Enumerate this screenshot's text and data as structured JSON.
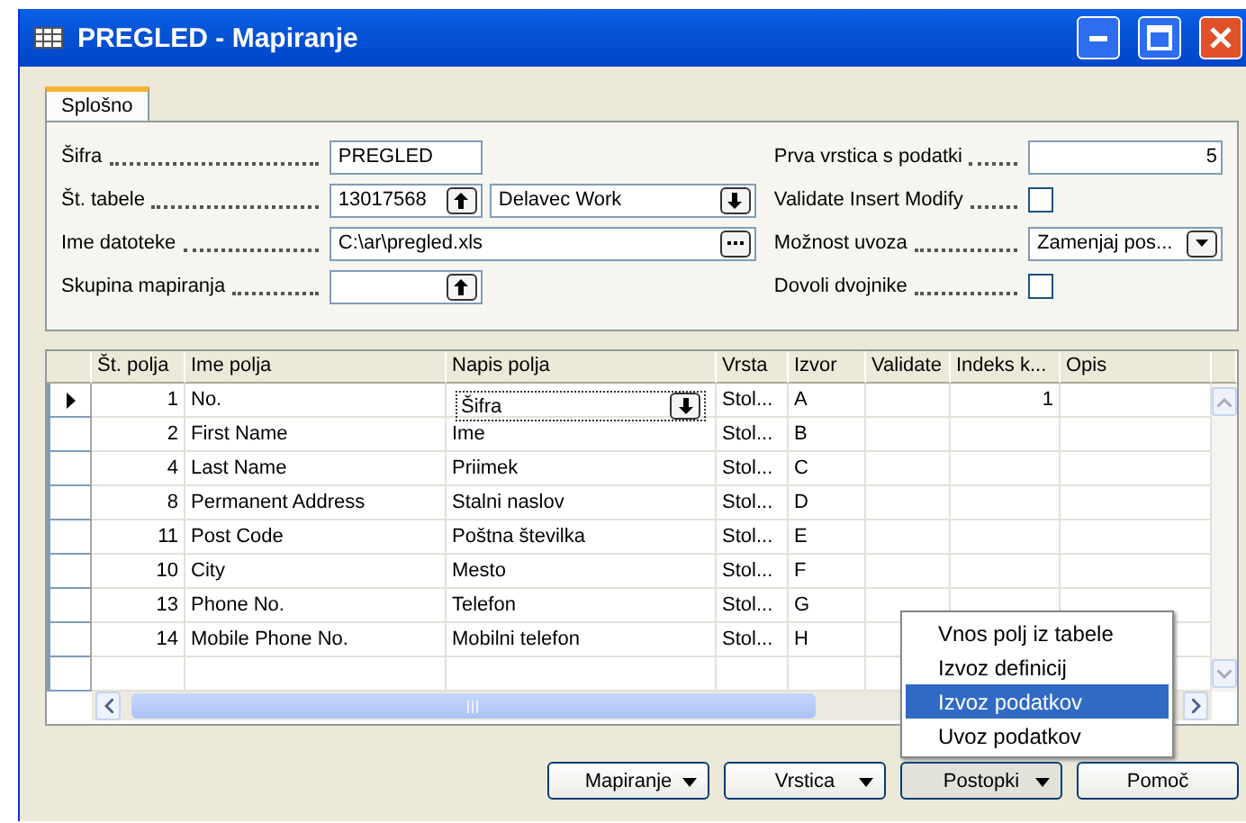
{
  "window": {
    "title": "PREGLED - Mapiranje"
  },
  "tabs": [
    {
      "label": "Splošno",
      "selected": true
    }
  ],
  "form": {
    "left": [
      {
        "label": "Šifra",
        "fields": [
          {
            "kind": "text",
            "value": "PREGLED"
          }
        ]
      },
      {
        "label": "Št. tabele",
        "fields": [
          {
            "kind": "lookup",
            "value": "13017568"
          },
          {
            "kind": "dropdown",
            "value": "Delavec Work"
          }
        ]
      },
      {
        "label": "Ime datoteke",
        "fields": [
          {
            "kind": "file",
            "value": "C:\\ar\\pregled.xls"
          }
        ]
      },
      {
        "label": "Skupina mapiranja",
        "fields": [
          {
            "kind": "lookup"
          }
        ]
      }
    ],
    "right": [
      {
        "label": "Prva vrstica s podatki",
        "kind": "number",
        "value": "5"
      },
      {
        "label": "Validate Insert Modify",
        "kind": "checkbox",
        "checked": false
      },
      {
        "label": "Možnost uvoza",
        "kind": "combo",
        "value": "Zamenjaj pos..."
      },
      {
        "label": "Dovoli dvojnike",
        "kind": "checkbox",
        "checked": false
      }
    ]
  },
  "table": {
    "columns": [
      "Št. polja",
      "Ime polja",
      "Napis polja",
      "Vrsta",
      "Izvor",
      "Validate",
      "Indeks k...",
      "Opis"
    ],
    "rows": [
      {
        "current": true,
        "cells": [
          "1",
          "No.",
          "Šifra",
          "Stol...",
          "A",
          null,
          "1"
        ]
      },
      {
        "current": false,
        "cells": [
          "2",
          "First Name",
          "Ime",
          "Stol...",
          "B"
        ]
      },
      {
        "current": false,
        "cells": [
          "4",
          "Last Name",
          "Priimek",
          "Stol...",
          "C"
        ]
      },
      {
        "current": false,
        "cells": [
          "8",
          "Permanent Address",
          "Stalni naslov",
          "Stol...",
          "D"
        ]
      },
      {
        "current": false,
        "cells": [
          "11",
          "Post Code",
          "Poštna številka",
          "Stol...",
          "E"
        ]
      },
      {
        "current": false,
        "cells": [
          "10",
          "City",
          "Mesto",
          "Stol...",
          "F"
        ]
      },
      {
        "current": false,
        "cells": [
          "13",
          "Phone No.",
          "Telefon",
          "Stol...",
          "G"
        ]
      },
      {
        "current": false,
        "cells": [
          "14",
          "Mobile Phone No.",
          "Mobilni telefon",
          "Stol...",
          "H"
        ]
      }
    ]
  },
  "menu": {
    "items": [
      {
        "label": "Vnos polj iz tabele",
        "selected": false
      },
      {
        "label": "Izvoz definicij",
        "selected": false
      },
      {
        "label": "Izvoz podatkov",
        "selected": true
      },
      {
        "label": "Uvoz podatkov",
        "selected": false
      }
    ]
  },
  "buttons": [
    {
      "label": "Mapiranje",
      "dropdown": true,
      "pressed": false
    },
    {
      "label": "Vrstica",
      "dropdown": true,
      "pressed": false
    },
    {
      "label": "Postopki",
      "dropdown": true,
      "pressed": true
    },
    {
      "label": "Pomoč",
      "dropdown": false,
      "pressed": false
    }
  ]
}
